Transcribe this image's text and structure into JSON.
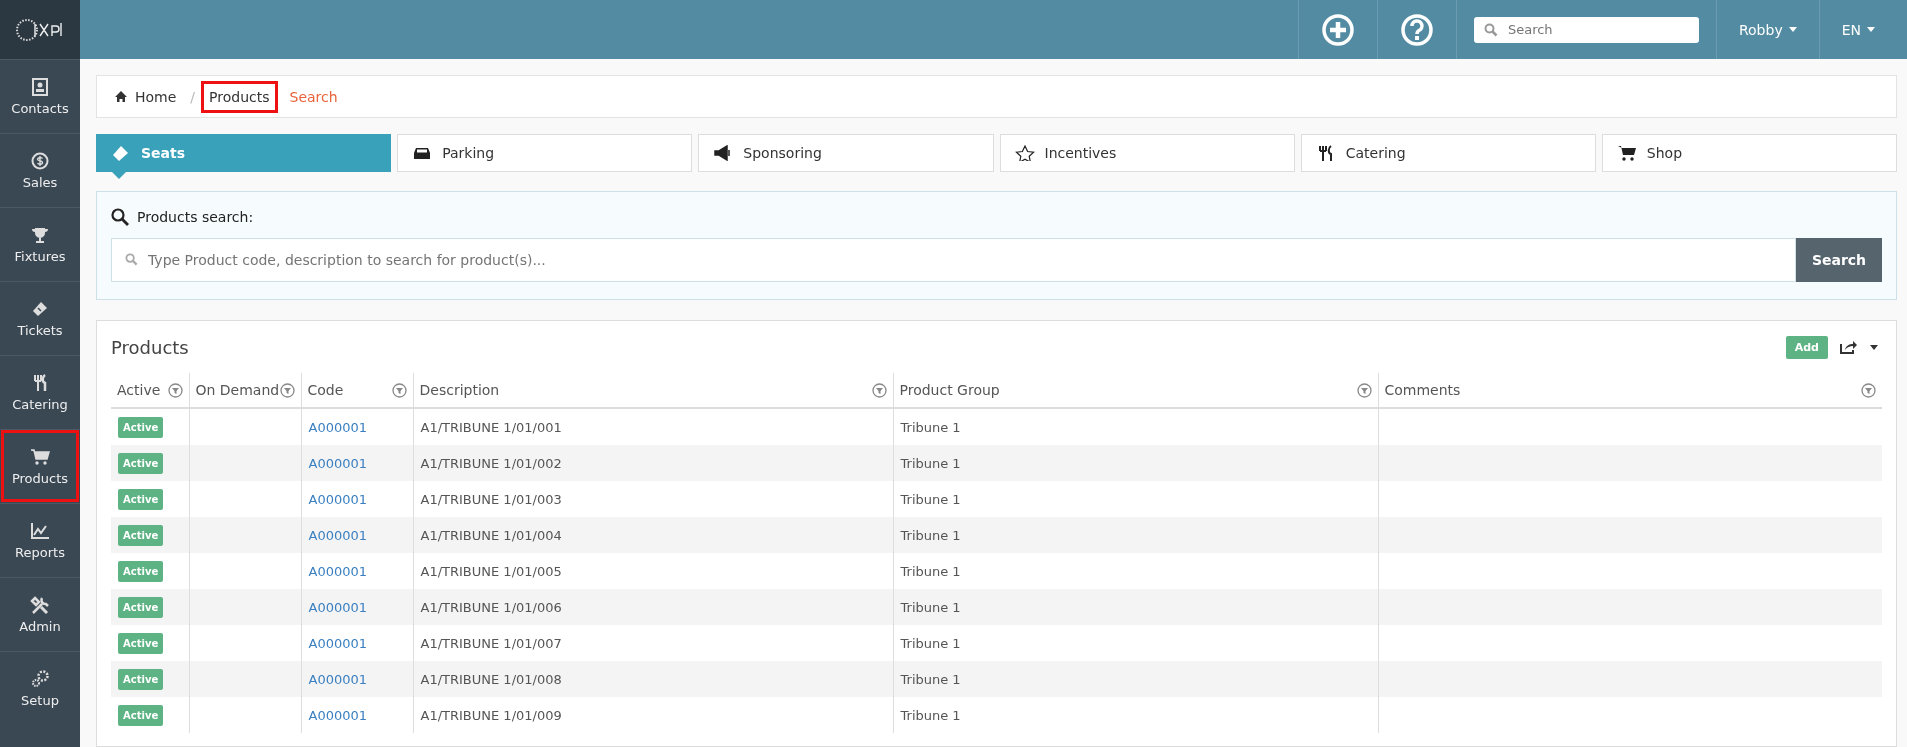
{
  "topbar": {
    "search": {
      "placeholder": "Search"
    },
    "user": "Robby",
    "language": "EN"
  },
  "sidebar": {
    "items": [
      {
        "label": "Contacts",
        "selected": false,
        "highlighted": false
      },
      {
        "label": "Sales",
        "selected": false,
        "highlighted": false
      },
      {
        "label": "Fixtures",
        "selected": false,
        "highlighted": false
      },
      {
        "label": "Tickets",
        "selected": false,
        "highlighted": false
      },
      {
        "label": "Catering",
        "selected": false,
        "highlighted": false
      },
      {
        "label": "Products",
        "selected": false,
        "highlighted": true
      },
      {
        "label": "Reports",
        "selected": false,
        "highlighted": false
      },
      {
        "label": "Admin",
        "selected": false,
        "highlighted": false
      },
      {
        "label": "Setup",
        "selected": false,
        "highlighted": false
      }
    ]
  },
  "breadcrumb": [
    {
      "label": "Home",
      "kind": "home",
      "highlighted": false
    },
    {
      "label": "Products",
      "kind": "link",
      "separator": "/",
      "highlighted": true
    },
    {
      "label": "Search",
      "kind": "current",
      "highlighted": false
    }
  ],
  "tabs": [
    {
      "label": "Seats",
      "selected": true
    },
    {
      "label": "Parking",
      "selected": false
    },
    {
      "label": "Sponsoring",
      "selected": false
    },
    {
      "label": "Incentives",
      "selected": false
    },
    {
      "label": "Catering",
      "selected": false
    },
    {
      "label": "Shop",
      "selected": false
    }
  ],
  "search_panel": {
    "title": "Products search:",
    "placeholder": "Type Product code, description to search for product(s)...",
    "button": "Search"
  },
  "products": {
    "title": "Products",
    "add_button": "Add",
    "columns": [
      "Active",
      "On Demand",
      "Code",
      "Description",
      "Product Group",
      "Comments"
    ],
    "rows": [
      {
        "status": "Active",
        "code": "A000001",
        "description": "A1/TRIBUNE 1/01/001",
        "group": "Tribune 1"
      },
      {
        "status": "Active",
        "code": "A000001",
        "description": "A1/TRIBUNE 1/01/002",
        "group": "Tribune 1"
      },
      {
        "status": "Active",
        "code": "A000001",
        "description": "A1/TRIBUNE 1/01/003",
        "group": "Tribune 1"
      },
      {
        "status": "Active",
        "code": "A000001",
        "description": "A1/TRIBUNE 1/01/004",
        "group": "Tribune 1"
      },
      {
        "status": "Active",
        "code": "A000001",
        "description": "A1/TRIBUNE 1/01/005",
        "group": "Tribune 1"
      },
      {
        "status": "Active",
        "code": "A000001",
        "description": "A1/TRIBUNE 1/01/006",
        "group": "Tribune 1"
      },
      {
        "status": "Active",
        "code": "A000001",
        "description": "A1/TRIBUNE 1/01/007",
        "group": "Tribune 1"
      },
      {
        "status": "Active",
        "code": "A000001",
        "description": "A1/TRIBUNE 1/01/008",
        "group": "Tribune 1"
      },
      {
        "status": "Active",
        "code": "A000001",
        "description": "A1/TRIBUNE 1/01/009",
        "group": "Tribune 1"
      }
    ]
  }
}
